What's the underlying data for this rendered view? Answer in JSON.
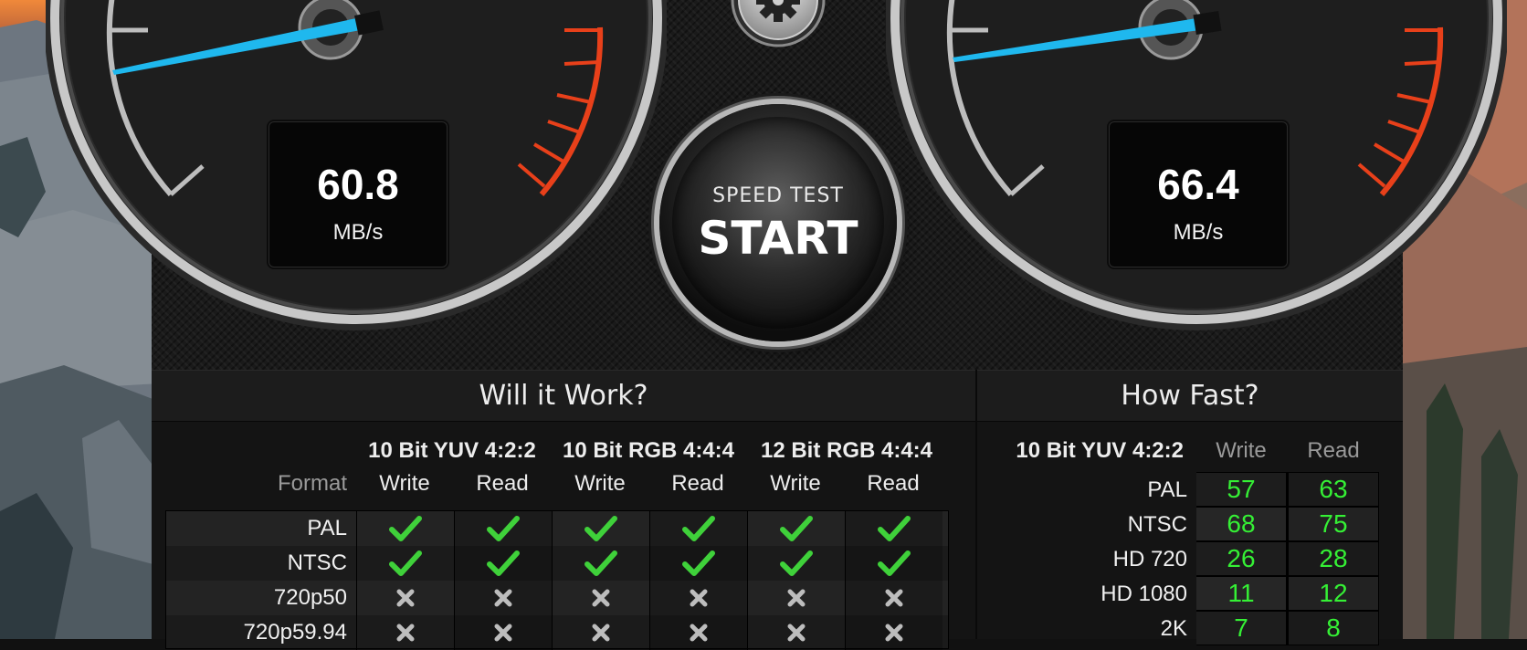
{
  "gauges": {
    "write": {
      "value": "60.8",
      "unit": "MB/s"
    },
    "read": {
      "value": "66.4",
      "unit": "MB/s"
    }
  },
  "start_button": {
    "small_label": "SPEED TEST",
    "big_label": "START"
  },
  "will_it_work": {
    "title": "Will it Work?",
    "format_label": "Format",
    "groups": [
      {
        "name": "10 Bit YUV 4:2:2",
        "cols": [
          "Write",
          "Read"
        ]
      },
      {
        "name": "10 Bit RGB 4:4:4",
        "cols": [
          "Write",
          "Read"
        ]
      },
      {
        "name": "12 Bit RGB 4:4:4",
        "cols": [
          "Write",
          "Read"
        ]
      }
    ],
    "rows": [
      {
        "format": "PAL",
        "results": [
          "check",
          "check",
          "check",
          "check",
          "check",
          "check"
        ]
      },
      {
        "format": "NTSC",
        "results": [
          "check",
          "check",
          "check",
          "check",
          "check",
          "check"
        ]
      },
      {
        "format": "720p50",
        "results": [
          "cross",
          "cross",
          "cross",
          "cross",
          "cross",
          "cross"
        ]
      },
      {
        "format": "720p59.94",
        "results": [
          "cross",
          "cross",
          "cross",
          "cross",
          "cross",
          "cross"
        ]
      }
    ]
  },
  "how_fast": {
    "title": "How Fast?",
    "codec": "10 Bit YUV 4:2:2",
    "col_write": "Write",
    "col_read": "Read",
    "rows": [
      {
        "format": "PAL",
        "write": "57",
        "read": "63"
      },
      {
        "format": "NTSC",
        "write": "68",
        "read": "75"
      },
      {
        "format": "HD 720",
        "write": "26",
        "read": "28"
      },
      {
        "format": "HD 1080",
        "write": "11",
        "read": "12"
      },
      {
        "format": "2K",
        "write": "7",
        "read": "8"
      }
    ]
  },
  "colors": {
    "needle": "#1fb8ee",
    "redzone": "#e8401a",
    "check": "#3fd13a",
    "fps_text": "#35f035"
  },
  "icons": {
    "settings": "gear-icon",
    "pass": "check-icon",
    "fail": "cross-icon"
  }
}
